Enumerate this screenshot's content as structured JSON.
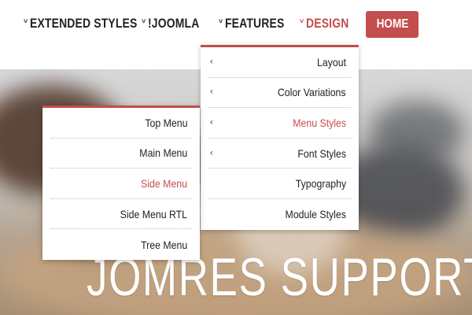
{
  "nav": {
    "items": [
      {
        "label": "EXTENDED STYLES",
        "caret": "˅"
      },
      {
        "label": "!JOOMLA",
        "caret": "˅"
      },
      {
        "label": "FEATURES",
        "caret": "˅"
      },
      {
        "label": "DESIGN",
        "caret": "˅"
      }
    ],
    "home_label": "HOME"
  },
  "design_menu": {
    "items": [
      {
        "label": "Layout",
        "arrow": "‹"
      },
      {
        "label": "Color Variations",
        "arrow": "‹"
      },
      {
        "label": "Menu Styles",
        "arrow": "‹"
      },
      {
        "label": "Font Styles",
        "arrow": "‹"
      },
      {
        "label": "Typography"
      },
      {
        "label": "Module Styles"
      }
    ]
  },
  "menu_styles_menu": {
    "items": [
      {
        "label": "Top Menu"
      },
      {
        "label": "Main Menu"
      },
      {
        "label": "Side Menu"
      },
      {
        "label": "Side Menu RTL"
      },
      {
        "label": "Tree Menu"
      }
    ]
  },
  "hero": {
    "title": "JOMRES SUPPORT"
  },
  "colors": {
    "accent": "#c44d4d",
    "text": "#222222"
  },
  "icons": {
    "caret": "chevron-down-icon",
    "submenu_arrow": "chevron-left-icon"
  }
}
